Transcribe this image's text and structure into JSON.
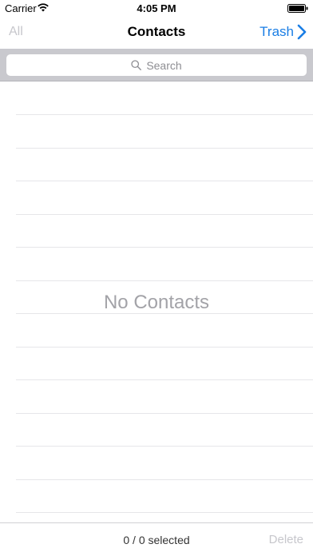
{
  "status_bar": {
    "carrier": "Carrier",
    "time": "4:05 PM",
    "wifi_icon": "wifi-icon",
    "battery_icon": "battery-full-icon"
  },
  "nav": {
    "left_label": "All",
    "title": "Contacts",
    "right_label": "Trash",
    "right_icon": "chevron-right-icon",
    "accent_color": "#1a7ee5"
  },
  "search": {
    "placeholder": "Search",
    "icon": "search-icon"
  },
  "list": {
    "empty_message": "No Contacts"
  },
  "toolbar": {
    "selection_count": "0 / 0 selected",
    "delete_label": "Delete"
  }
}
